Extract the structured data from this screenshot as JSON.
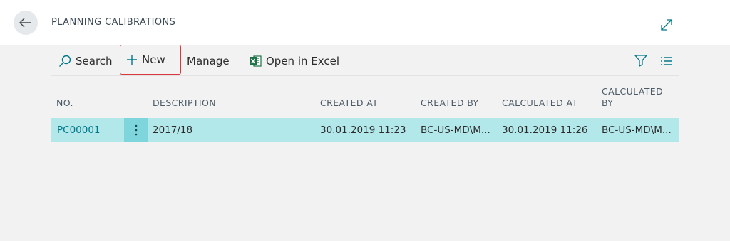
{
  "header": {
    "title": "PLANNING CALIBRATIONS",
    "back_icon": "arrow-left-icon",
    "expand_icon": "expand-icon"
  },
  "actions": {
    "search": "Search",
    "new": "New",
    "manage": "Manage",
    "excel": "Open in Excel"
  },
  "table": {
    "columns": {
      "no": "NO.",
      "description": "DESCRIPTION",
      "created_at": "CREATED AT",
      "created_by": "CREATED BY",
      "calculated_at": "CALCULATED AT",
      "calculated_by_1": "CALCULATED",
      "calculated_by_2": "BY"
    },
    "rows": [
      {
        "no": "PC00001",
        "description": "2017/18",
        "created_at": "30.01.2019 11:23",
        "created_by": "BC-US-MD\\M...",
        "calculated_at": "30.01.2019 11:26",
        "calculated_by": "BC-US-MD\\M..."
      }
    ]
  },
  "colors": {
    "accent": "#00788a",
    "selected_row": "#b3e8eb",
    "row_menu": "#7fd5dc",
    "highlight_border": "#d9393e"
  }
}
